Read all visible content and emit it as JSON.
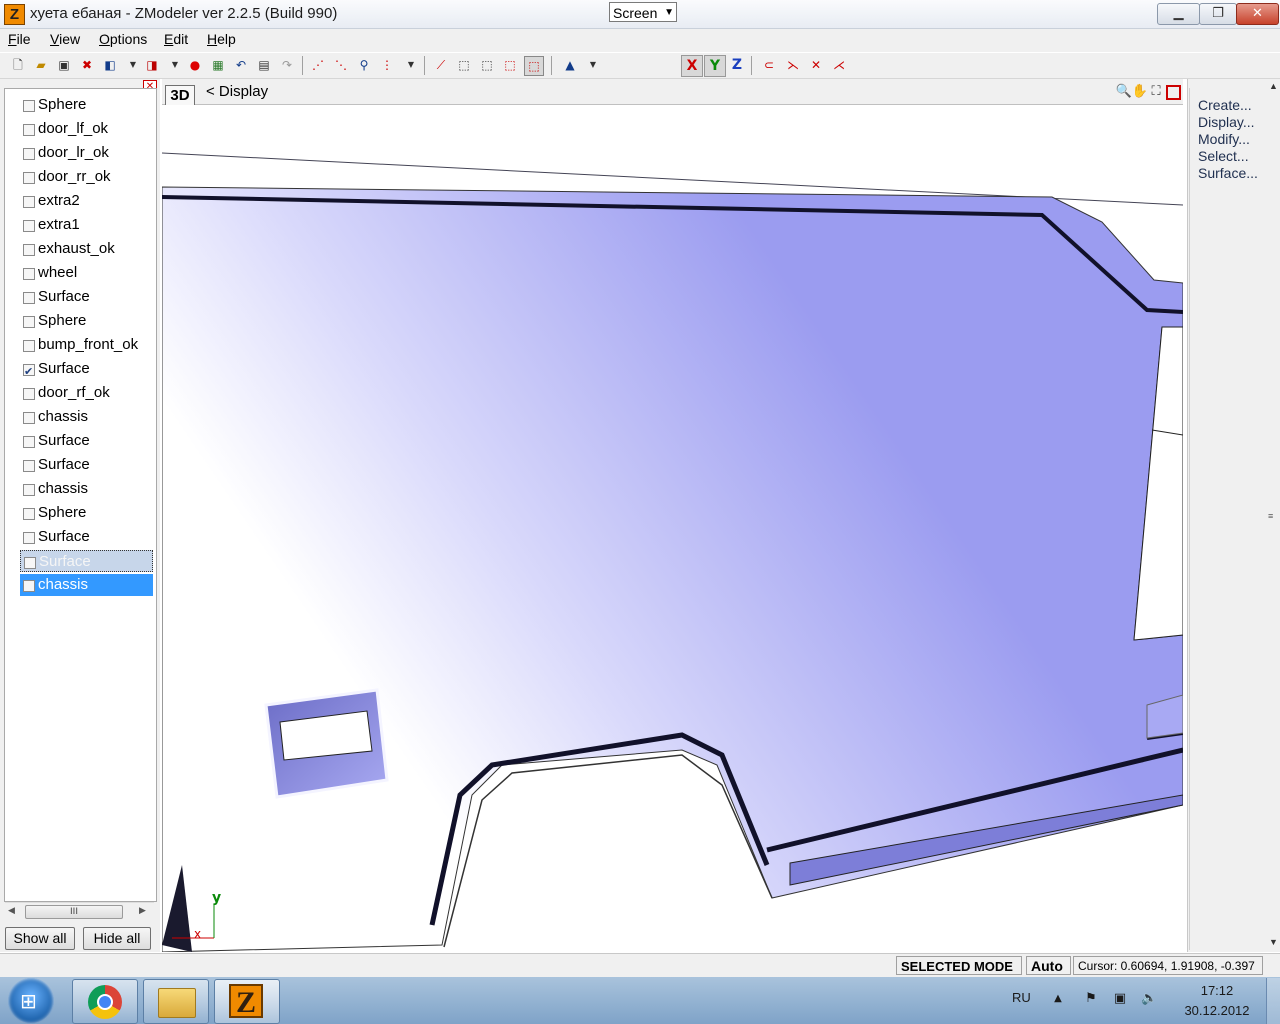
{
  "window": {
    "title": "хуета ебаная - ZModeler ver 2.2.5 (Build 990)",
    "app_icon_letter": "Z",
    "min_symbol": "▁",
    "max_symbol": "❐",
    "close_symbol": "✕"
  },
  "menu": {
    "items": [
      {
        "u": "F",
        "rest": "ile"
      },
      {
        "u": "V",
        "rest": "iew"
      },
      {
        "u": "O",
        "rest": "ptions"
      },
      {
        "u": "E",
        "rest": "dit"
      },
      {
        "u": "H",
        "rest": "elp"
      }
    ]
  },
  "toolbar": {
    "view_select": "Screen",
    "axis_x": "X",
    "axis_y": "Y",
    "axis_z": "Z",
    "icons": [
      "new-file-icon",
      "open-folder-icon",
      "save-icon",
      "delete-icon",
      "import-icon",
      "dropdown-arrow-icon",
      "export-icon",
      "dropdown-arrow-icon",
      "red-sphere-icon",
      "render-icon",
      "undo-icon",
      "properties-icon",
      "redo-icon",
      "select-vertex-icon",
      "select-edge-icon",
      "walk-icon",
      "select-group-icon",
      "dropdown-arrow-icon",
      "wire-icon",
      "box-icon",
      "box-icon",
      "box-icon",
      "box-active-icon",
      "cone-icon",
      "dropdown-arrow-icon",
      "magnet-icon",
      "axes-icon",
      "axes-icon",
      "axes-icon"
    ]
  },
  "layers": {
    "items": [
      {
        "label": "Sphere",
        "checked": false,
        "state": ""
      },
      {
        "label": "door_lf_ok",
        "checked": false,
        "state": ""
      },
      {
        "label": "door_lr_ok",
        "checked": false,
        "state": ""
      },
      {
        "label": "door_rr_ok",
        "checked": false,
        "state": ""
      },
      {
        "label": "extra2",
        "checked": false,
        "state": ""
      },
      {
        "label": "extra1",
        "checked": false,
        "state": ""
      },
      {
        "label": "exhaust_ok",
        "checked": false,
        "state": ""
      },
      {
        "label": "wheel",
        "checked": false,
        "state": ""
      },
      {
        "label": "Surface",
        "checked": false,
        "state": ""
      },
      {
        "label": "Sphere",
        "checked": false,
        "state": ""
      },
      {
        "label": "bump_front_ok",
        "checked": false,
        "state": ""
      },
      {
        "label": "Surface",
        "checked": true,
        "state": ""
      },
      {
        "label": "door_rf_ok",
        "checked": false,
        "state": ""
      },
      {
        "label": "chassis",
        "checked": false,
        "state": ""
      },
      {
        "label": "Surface",
        "checked": false,
        "state": ""
      },
      {
        "label": "Surface",
        "checked": false,
        "state": ""
      },
      {
        "label": "chassis",
        "checked": false,
        "state": ""
      },
      {
        "label": "Sphere",
        "checked": false,
        "state": ""
      },
      {
        "label": "Surface",
        "checked": false,
        "state": ""
      },
      {
        "label": "Surface",
        "checked": false,
        "state": "sel-dim"
      },
      {
        "label": "chassis",
        "checked": false,
        "state": "sel"
      }
    ],
    "scroll_thumb": "III",
    "show_all": "Show all",
    "hide_all": "Hide all",
    "close_symbol": "✕"
  },
  "viewport": {
    "mode": "3D",
    "display_label": "<  Display",
    "axis_y_label": "y",
    "axis_x_label": "x",
    "fill_color": "#9b9cf0"
  },
  "command_panel": {
    "items": [
      "Create...",
      "Display...",
      "Modify...",
      "Select...",
      "Surface..."
    ]
  },
  "status": {
    "mode": "SELECTED MODE",
    "auto": "Auto",
    "cursor": "Cursor: 0.60694, 1.91908, -0.397"
  },
  "taskbar": {
    "lang": "RU",
    "time": "17:12",
    "date": "30.12.2012"
  }
}
